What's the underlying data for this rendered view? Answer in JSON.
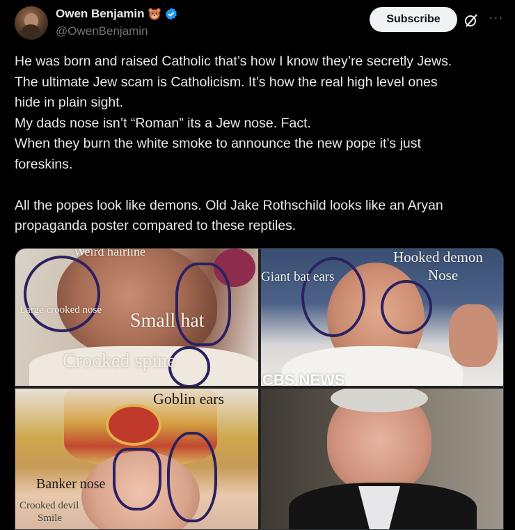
{
  "author": {
    "display_name": "Owen Benjamin",
    "handle": "@OwenBenjamin",
    "badge_emoji": "bear-face-icon",
    "verified": "verified-badge-icon"
  },
  "actions": {
    "subscribe_label": "Subscribe",
    "grok_icon": "grok-icon",
    "more_icon": "more-icon"
  },
  "tweet": {
    "lines": [
      "He was born and raised Catholic that’s how I know they’re secretly Jews.",
      "The ultimate Jew scam is Catholicism. It’s how the real high level ones",
      "hide in plain sight.",
      "My dads nose isn’t “Roman” its a Jew nose. Fact.",
      "When they burn the white smoke to announce the new pope it’s just",
      "foreskins.",
      "All the popes look like demons. Old Jake Rothschild looks like an Aryan",
      "propaganda poster compared to these reptiles."
    ]
  },
  "media": {
    "cell1": {
      "weird_hairline": "Weird hairline",
      "large_crooked_nose": "Large crooked nose",
      "small_hat": "Small hat",
      "crooked_spine": "Crooked spine"
    },
    "cell2": {
      "hooked_demon": "Hooked demon",
      "nose": "Nose",
      "giant_bat_ears": "Giant bat ears",
      "watermark": "CBS NEWS"
    },
    "cell3": {
      "goblin_ears": "Goblin ears",
      "banker_nose": "Banker nose",
      "crooked_devil": "Crooked devil",
      "smile": "Smile"
    }
  },
  "colors": {
    "background": "#000000",
    "text": "#e7e9ea",
    "secondary_text": "#71767b",
    "verified_blue": "#1d9bf0",
    "subscribe_bg": "#eff3f4",
    "ink_circle": "#2b2160"
  }
}
